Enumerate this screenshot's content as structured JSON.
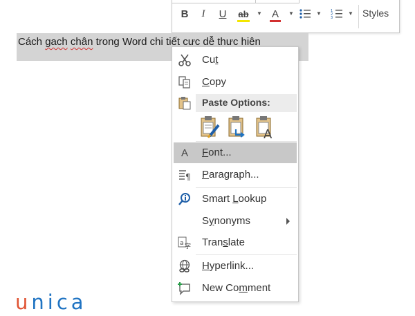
{
  "mini_toolbar": {
    "bold": "B",
    "italic": "I",
    "underline": "U",
    "highlight": "ab",
    "font_color": "A",
    "styles_label": "Styles"
  },
  "document": {
    "parts": [
      "Cách ",
      "gach",
      " ",
      "chân",
      " trong Word chi tiết ",
      "cưc",
      " dễ thưc hiên"
    ]
  },
  "context_menu": {
    "cut": {
      "pre": "Cu",
      "mn": "t",
      "post": ""
    },
    "copy": {
      "pre": "",
      "mn": "C",
      "post": "opy"
    },
    "paste_options_label": "Paste Options:",
    "font": {
      "pre": "",
      "mn": "F",
      "post": "ont..."
    },
    "paragraph": {
      "pre": "",
      "mn": "P",
      "post": "aragraph..."
    },
    "smart_lookup": {
      "pre": "Smart ",
      "mn": "L",
      "post": "ookup"
    },
    "synonyms": {
      "pre": "S",
      "mn": "y",
      "post": "nonyms"
    },
    "translate": {
      "pre": "Tran",
      "mn": "s",
      "post": "late"
    },
    "hyperlink": {
      "pre": "",
      "mn": "H",
      "post": "yperlink..."
    },
    "new_comment": {
      "pre": "New Co",
      "mn": "m",
      "post": "ment"
    }
  },
  "brand": {
    "u": "u",
    "rest": "nica"
  },
  "colors": {
    "accent_blue": "#1f73c2",
    "brand_orange": "#e05434",
    "highlight_gray": "#c8c8c8",
    "font_red": "#d23030"
  }
}
